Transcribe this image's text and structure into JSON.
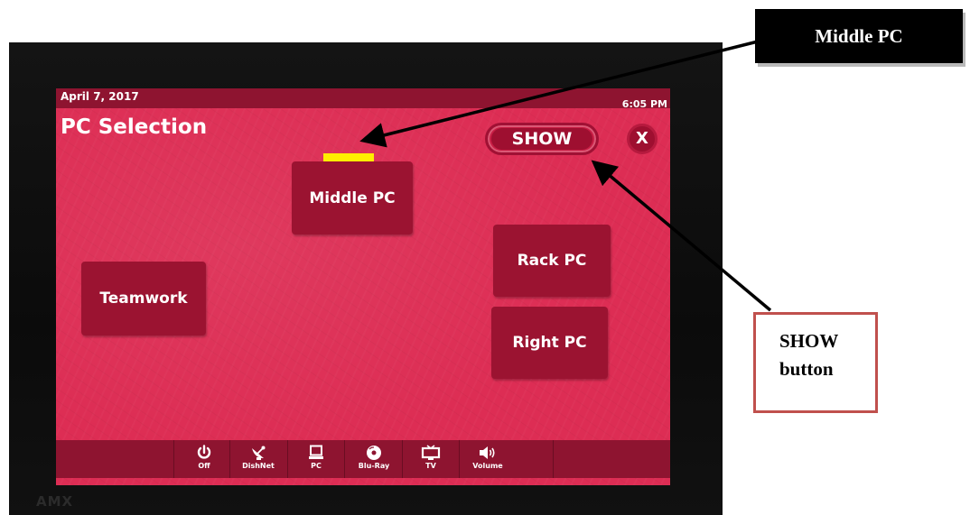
{
  "panel": {
    "date": "April 7, 2017",
    "time": "6:05 PM",
    "title": "PC Selection",
    "show_label": "SHOW",
    "close_label": "X",
    "buttons": {
      "middle_pc": "Middle PC",
      "rack_pc": "Rack PC",
      "right_pc": "Right PC",
      "teamwork": "Teamwork"
    },
    "nav": [
      {
        "label": "Off",
        "icon": "power-icon"
      },
      {
        "label": "DishNet",
        "icon": "satellite-dish-icon"
      },
      {
        "label": "PC",
        "icon": "laptop-icon"
      },
      {
        "label": "Blu-Ray",
        "icon": "disc-icon"
      },
      {
        "label": "TV",
        "icon": "tv-icon"
      },
      {
        "label": "Volume",
        "icon": "speaker-icon"
      }
    ],
    "highlight_color": "#ffee00",
    "screen_color": "#dd2d54",
    "button_color": "#9b1331"
  },
  "annotations": {
    "middle_pc_callout": "Middle PC",
    "show_callout_line1": "SHOW",
    "show_callout_line2": "button"
  }
}
